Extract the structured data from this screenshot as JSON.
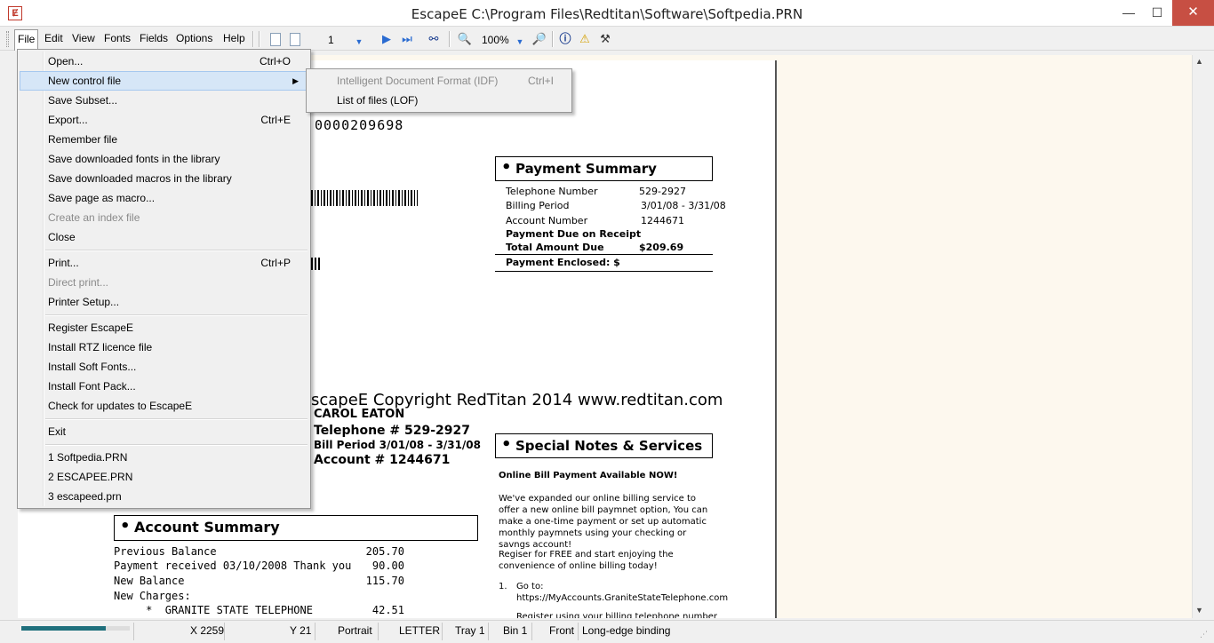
{
  "window": {
    "title": "EscapeE C:\\Program Files\\Redtitan\\Software\\Softpedia.PRN",
    "min": "—",
    "max": "☐",
    "close": "✕"
  },
  "menu": {
    "file": "File",
    "edit": "Edit",
    "view": "View",
    "fonts": "Fonts",
    "fields": "Fields",
    "options": "Options",
    "help": "Help"
  },
  "toolbar": {
    "page_number": "1",
    "zoom": "100%"
  },
  "file_menu": {
    "items": [
      {
        "label": "Open...",
        "shortcut": "Ctrl+O"
      },
      {
        "label": "New control file"
      },
      {
        "label": "Save Subset..."
      },
      {
        "label": "Export...",
        "shortcut": "Ctrl+E"
      },
      {
        "label": "Remember file"
      },
      {
        "label": "Save downloaded fonts in the library"
      },
      {
        "label": "Save downloaded macros in the library"
      },
      {
        "label": "Save page as macro..."
      },
      {
        "label": "Create an index file"
      },
      {
        "label": "Close"
      },
      {
        "label": "Print...",
        "shortcut": "Ctrl+P"
      },
      {
        "label": "Direct print..."
      },
      {
        "label": "Printer Setup..."
      },
      {
        "label": "Register EscapeE"
      },
      {
        "label": "Install RTZ licence file"
      },
      {
        "label": "Install Soft Fonts..."
      },
      {
        "label": "Install Font Pack..."
      },
      {
        "label": "Check for updates to EscapeE"
      },
      {
        "label": "Exit"
      },
      {
        "label": "1 Softpedia.PRN"
      },
      {
        "label": "2 ESCAPEE.PRN"
      },
      {
        "label": "3 escapeed.prn"
      }
    ]
  },
  "submenu": {
    "items": [
      {
        "label": "Intelligent Document Format (IDF)",
        "shortcut": "Ctrl+I"
      },
      {
        "label": "List of files (LOF)"
      }
    ]
  },
  "document": {
    "doc_number": "0000209698",
    "payment_summary": {
      "title": "Payment Summary",
      "telephone_label": "Telephone Number",
      "telephone_value": "529-2927",
      "billing_label": "Billing Period",
      "billing_value": "3/01/08 -  3/31/08",
      "account_label": "Account Number",
      "account_value": "1244671",
      "due_label": "Payment Due on Receipt",
      "total_label": "Total Amount Due",
      "total_value": "$209.69",
      "enclosed_label": "Payment Enclosed: $"
    },
    "copyright": "scapeE Copyright RedTitan 2014 www.redtitan.com",
    "customer": {
      "name": "CAROL EATON",
      "telephone": "Telephone # 529-2927",
      "bill_period": "Bill Period  3/01/08 -  3/31/08",
      "account": "Account # 1244671"
    },
    "special_notes": {
      "title": "Special Notes & Services",
      "headline": "Online Bill Payment Available NOW!",
      "para1": "We've expanded our online billing service to offer a new online bill paymnet option, You can make a one-time payment or set up automatic monthly paymnets using your checking or savngs account!",
      "para2": "Regiser for FREE and start enjoying the convenience of online billing today!",
      "step1_num": "1.",
      "step1": "Go to: https://MyAccounts.GraniteStateTelephone.com",
      "step2": "Register using your billing telephone number"
    },
    "account_summary": {
      "title": "Account Summary",
      "rows": [
        {
          "label": "Previous Balance",
          "value": "205.70"
        },
        {
          "label": "Payment received 03/10/2008 Thank you",
          "value": "90.00"
        },
        {
          "label": "New Balance",
          "value": "115.70"
        },
        {
          "label": "New Charges:",
          "value": ""
        },
        {
          "label": "     *  GRANITE STATE TELEPHONE",
          "value": "42.51"
        }
      ]
    }
  },
  "statusbar": {
    "progress": 0.78,
    "x": "X 2259",
    "y": "Y 21",
    "orientation": "Portrait",
    "paper": "LETTER",
    "tray": "Tray 1",
    "bin": "Bin 1",
    "side": "Front",
    "binding": "Long-edge binding"
  },
  "colors": {
    "accent": "#1f6f7c",
    "close_button": "#c74f43",
    "menu_highlight": "#d6e6f7"
  }
}
